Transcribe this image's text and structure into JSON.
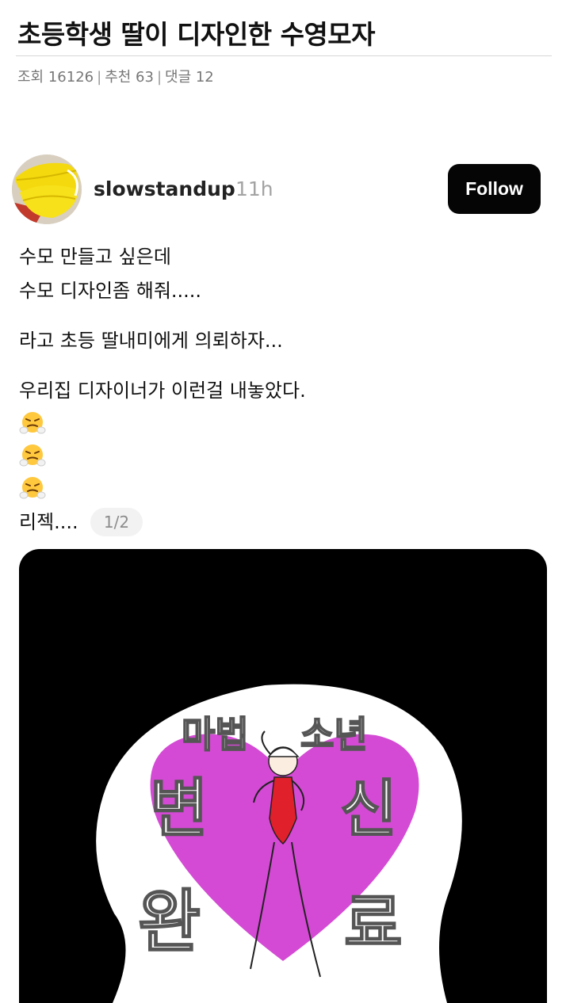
{
  "article": {
    "title": "초등학생 딸이 디자인한 수영모자",
    "meta": {
      "views_label": "조회 16126",
      "recommend_label": "추천 63",
      "comments_label": "댓글 12",
      "separator": "|"
    }
  },
  "post": {
    "username": "slowstandup",
    "time": "11h",
    "follow_label": "Follow",
    "text_lines": [
      "수모 만들고 싶은데",
      "수모 디자인좀 해줘.....",
      "라고 초등 딸내미에게 의뢰하자...",
      "우리집 디자이너가 이런걸 내놓았다.",
      "리젝...."
    ],
    "emoji_icon": "face-with-steam-emoji",
    "page_indicator": "1/2"
  },
  "media": {
    "caps_drawing_text": [
      "마법",
      "소년",
      "변",
      "신",
      "완",
      "료"
    ],
    "colors": {
      "background": "#000000",
      "cap": "#ffffff",
      "heart": "#d44ad4",
      "swimsuit": "#e0202a"
    }
  },
  "colors": {
    "follow_button_bg": "#050505",
    "meta_text": "#777777",
    "time_text": "#a3a3a3"
  }
}
